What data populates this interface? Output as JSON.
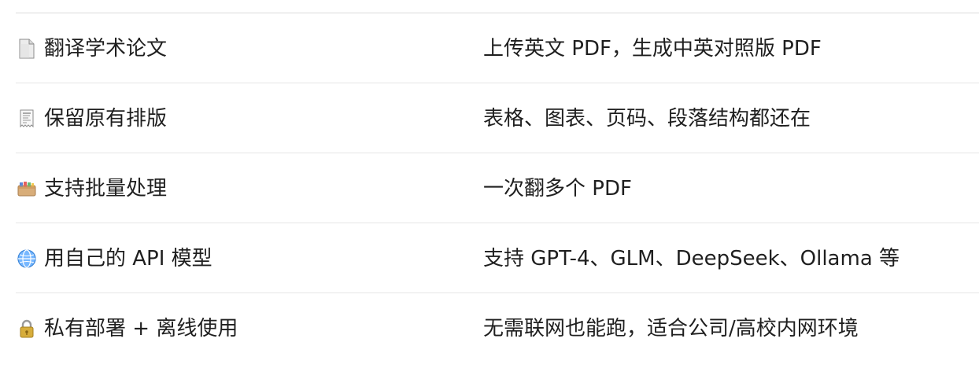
{
  "rows": [
    {
      "icon": "document-icon",
      "feature": "翻译学术论文",
      "description": "上传英文 PDF，生成中英对照版 PDF"
    },
    {
      "icon": "receipt-icon",
      "feature": "保留原有排版",
      "description": "表格、图表、页码、段落结构都还在"
    },
    {
      "icon": "card-box-icon",
      "feature": "支持批量处理",
      "description": "一次翻多个 PDF"
    },
    {
      "icon": "globe-icon",
      "feature": "用自己的 API 模型",
      "description": "支持 GPT-4、GLM、DeepSeek、Ollama 等"
    },
    {
      "icon": "lock-icon",
      "feature": "私有部署 + 离线使用",
      "description": "无需联网也能跑，适合公司/高校内网环境"
    }
  ],
  "colors": {
    "text": "#1f1f1f",
    "divider": "#e6e6e6",
    "top_border": "#dcdcdc"
  }
}
